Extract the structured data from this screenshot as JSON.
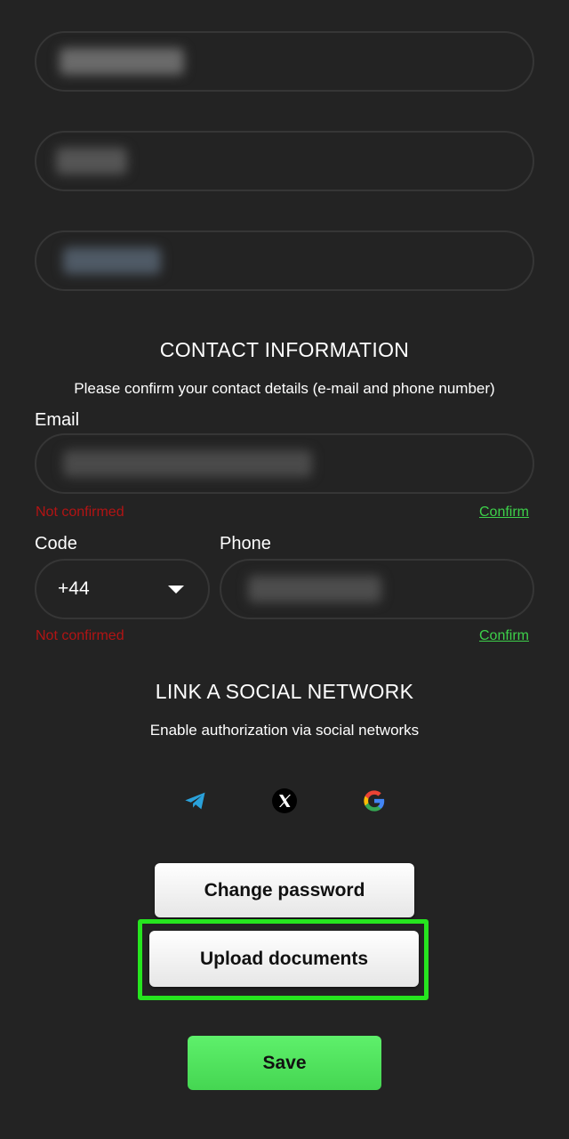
{
  "profile_fields": [
    {
      "name": "field-1"
    },
    {
      "name": "field-2"
    },
    {
      "name": "field-3"
    }
  ],
  "contact": {
    "title": "CONTACT INFORMATION",
    "subtitle": "Please confirm your contact details (e-mail and phone number)",
    "email_label": "Email",
    "email_status": "Not confirmed",
    "email_confirm": "Confirm",
    "code_label": "Code",
    "code_value": "+44",
    "phone_label": "Phone",
    "phone_status": "Not confirmed",
    "phone_confirm": "Confirm"
  },
  "social": {
    "title": "LINK A SOCIAL NETWORK",
    "subtitle": "Enable authorization via social networks",
    "networks": [
      "telegram-icon",
      "x-icon",
      "google-icon"
    ]
  },
  "buttons": {
    "change_password": "Change password",
    "upload_documents": "Upload documents",
    "save": "Save"
  },
  "colors": {
    "background": "#232323",
    "error": "#b21414",
    "confirm": "#3dd04a",
    "highlight": "#26e51f",
    "save": "#4fe05c"
  }
}
